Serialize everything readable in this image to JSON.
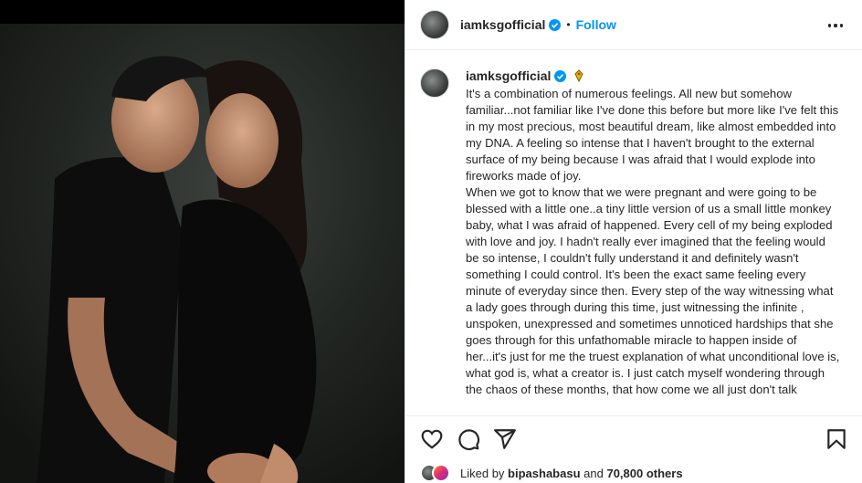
{
  "post": {
    "username": "iamksgofficial",
    "follow_label": "Follow",
    "separator": "•",
    "caption": "It's a combination of numerous feelings. All new but somehow familiar...not familiar like I've done this before but more like I've felt this in my most precious, most beautiful dream, like almost embedded into my DNA. A feeling so intense that I haven't brought to the external surface of my being because I was afraid that I would explode into fireworks made of joy.\nWhen we got to know that we were pregnant and were going to be blessed with a little one..a tiny little version of us a small little monkey baby, what I was afraid of happened. Every cell of my being exploded with love and joy. I hadn't really ever imagined that the feeling would be so intense, I couldn't fully understand it and definitely wasn't something I could control. It's been the exact same feeling every minute of everyday since then. Every step of the way witnessing what a lady goes through during this time, just witnessing the infinite , unspoken, unexpressed and sometimes unnoticed hardships that she goes through for this unfathomable miracle to happen inside of her...it's just for me the truest explanation of what unconditional love is, what god is, what a creator is. I just catch myself wondering through the chaos of these months, that how come we all just don't talk"
  },
  "likes": {
    "prefix": "Liked by",
    "user": "bipashabasu",
    "and": "and",
    "count": "70,800 others"
  },
  "icons": {
    "verified": "verified-badge-icon",
    "more": "more-options-icon",
    "like": "heart-icon",
    "comment": "comment-icon",
    "share": "share-icon",
    "save": "bookmark-icon",
    "emoji": "emoji-icon"
  },
  "colors": {
    "accent": "#0095f6",
    "text": "#262626",
    "border": "#efefef"
  }
}
